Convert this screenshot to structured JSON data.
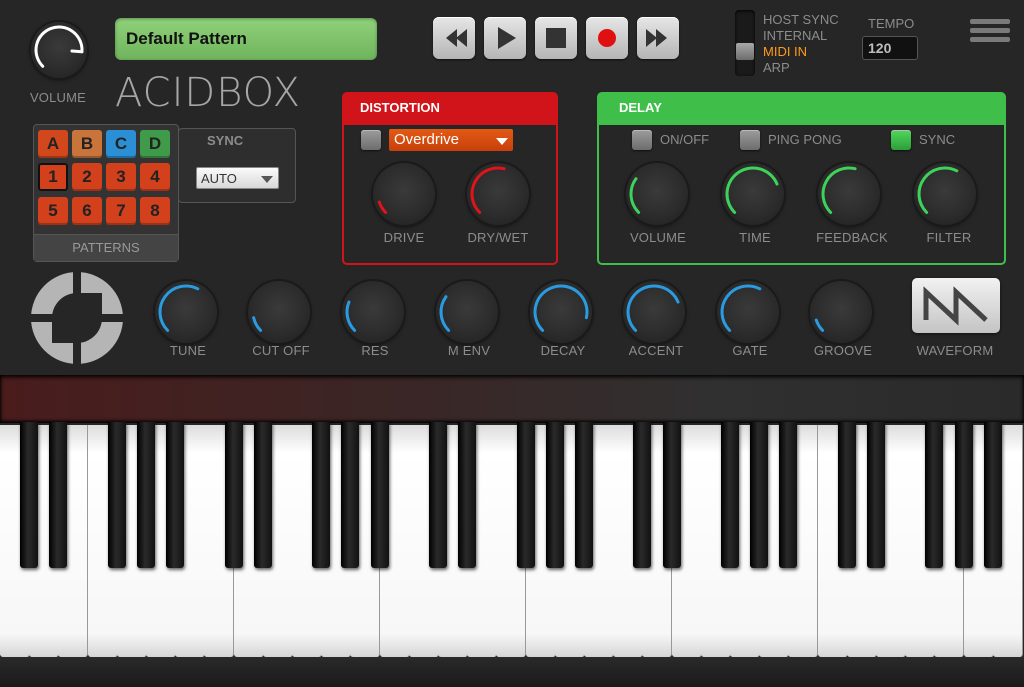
{
  "app": {
    "title": "ACIDBOX",
    "pattern_name": "Default Pattern"
  },
  "volume": {
    "label": "VOLUME",
    "value": 0.85
  },
  "sync_modes": {
    "items": [
      "HOST SYNC",
      "INTERNAL",
      "MIDI IN",
      "ARP"
    ],
    "active_index": 2
  },
  "tempo": {
    "label": "TEMPO",
    "value": "120"
  },
  "patterns": {
    "banks": [
      "A",
      "B",
      "C",
      "D"
    ],
    "numbers": [
      "1",
      "2",
      "3",
      "4",
      "5",
      "6",
      "7",
      "8"
    ],
    "selected_number": "1",
    "label": "PATTERNS",
    "sync_label": "SYNC",
    "sync_value": "AUTO"
  },
  "distortion": {
    "title": "DISTORTION",
    "type": "Overdrive",
    "enabled": false,
    "knobs": [
      {
        "label": "DRIVE",
        "value": 0.1
      },
      {
        "label": "DRY/WET",
        "value": 0.55
      }
    ]
  },
  "delay": {
    "title": "DELAY",
    "onoff_label": "ON/OFF",
    "pingpong_label": "PING PONG",
    "sync_label": "SYNC",
    "onoff": false,
    "pingpong": false,
    "sync": true,
    "knobs": [
      {
        "label": "VOLUME",
        "value": 0.3
      },
      {
        "label": "TIME",
        "value": 0.75
      },
      {
        "label": "FEEDBACK",
        "value": 0.55
      },
      {
        "label": "FILTER",
        "value": 0.6
      }
    ]
  },
  "synth": {
    "knobs": [
      {
        "label": "TUNE",
        "value": 0.6
      },
      {
        "label": "CUT OFF",
        "value": 0.12
      },
      {
        "label": "RES",
        "value": 0.25
      },
      {
        "label": "M ENV",
        "value": 0.3
      },
      {
        "label": "DECAY",
        "value": 0.88
      },
      {
        "label": "ACCENT",
        "value": 0.75
      },
      {
        "label": "GATE",
        "value": 0.6
      },
      {
        "label": "GROOVE",
        "value": 0.1
      }
    ],
    "waveform_label": "WAVEFORM",
    "waveform": "sawtooth"
  },
  "colors": {
    "distortion": "#d0141a",
    "delay": "#3fbf4a",
    "synth_knob": "#2a9be0",
    "delay_knob": "#3fd25a",
    "dist_knob": "#e0141a",
    "active_mode": "#ff9a1a",
    "pattern_a": "#d2481c",
    "pattern_b": "#c8743a",
    "pattern_c": "#2a8fd4",
    "pattern_d": "#3f9a4a",
    "pattern_num": "#d2401c"
  },
  "icons": {
    "logo": "acidbox-logo-icon",
    "menu": "hamburger-menu-icon",
    "rewind": "rewind-icon",
    "play": "play-icon",
    "stop": "stop-icon",
    "record": "record-icon",
    "forward": "fast-forward-icon"
  }
}
